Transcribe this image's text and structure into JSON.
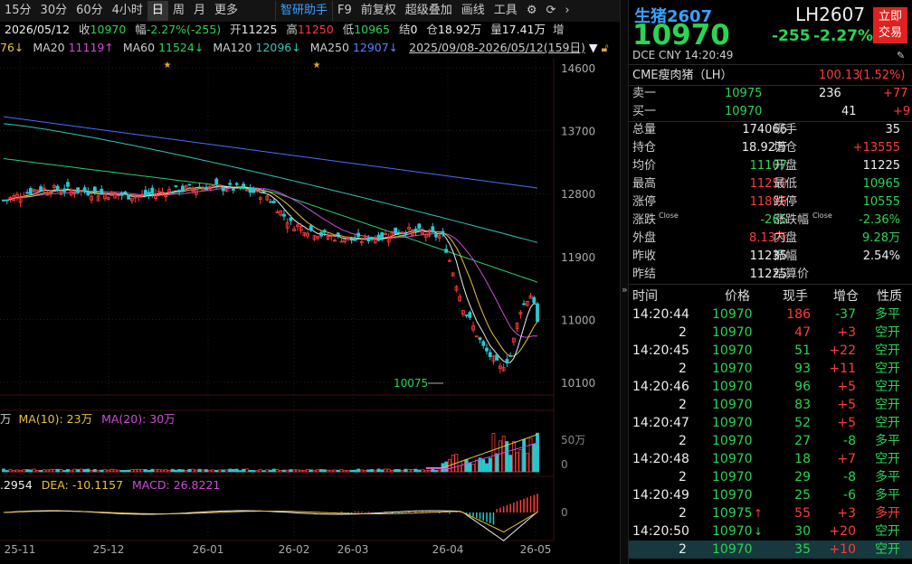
{
  "toolbar": {
    "items": [
      "15分",
      "30分",
      "60分",
      "4小时",
      "日",
      "周",
      "月",
      "更多"
    ],
    "active": "日",
    "assistant": "智研助手",
    "f9": "F9",
    "adjust": "前复权",
    "overlay": "超级叠加",
    "draw": "画线",
    "tools": "工具"
  },
  "infobar": {
    "date": "2026/05/12",
    "close_label": "收",
    "close": "10970",
    "chg_label": "幅",
    "chg": "-2.27%(-255)",
    "open_label": "开",
    "open": "11225",
    "high_label": "高",
    "high": "11250",
    "low_label": "低",
    "low": "10965",
    "settle_label": "结",
    "settle": "0",
    "oi_label": "仓",
    "oi": "18.92万",
    "vol_label": "量",
    "vol": "17.41万"
  },
  "mabar": {
    "ma5_tail": "76↓",
    "ma20_label": "MA20",
    "ma20": "11119↑",
    "ma60_label": "MA60",
    "ma60": "11524↓",
    "ma120_label": "MA120",
    "ma120": "12096↓",
    "ma250_label": "MA250",
    "ma250": "12907↓",
    "range": "2025/09/08-2026/05/12(159日)"
  },
  "vol_panel": {
    "ma10_label": "MA(10): 23万",
    "ma20_label": "MA(20): 30万",
    "prefix": "万",
    "axis_top": "50万",
    "axis_zero": "0"
  },
  "macd_panel": {
    "dif_tail": ".2954",
    "dea_label": "DEA: -10.1157",
    "macd_label": "MACD: 26.8221",
    "axis_zero": "0"
  },
  "chart_data": {
    "type": "candlestick",
    "y_ticks": [
      "14600",
      "13700",
      "12800",
      "11900",
      "11000",
      "10100"
    ],
    "ylim": [
      10100,
      14600
    ],
    "x_ticks": [
      "25-11",
      "25-12",
      "26-01",
      "26-02",
      "26-03",
      "26-04",
      "26-05"
    ],
    "low_annotation": "10075",
    "ma_colors": {
      "ma5": "#eeeeee",
      "ma10": "#e8c23a",
      "ma20": "#d04cd6",
      "ma60": "#2ecc71",
      "ma120": "#2fc4b8",
      "ma250": "#4a6cff"
    },
    "up_color": "#ff3b3b",
    "down_color": "#28c8d0"
  },
  "quote": {
    "name": "生猪2607",
    "code": "LH2607",
    "price": "10970",
    "change": "-255",
    "change_pct": "-2.27%",
    "trade_btn_1": "立即",
    "trade_btn_2": "交易",
    "exchange": "DCE",
    "currency": "CNY",
    "time": "14:20:49",
    "ref_name": "CME瘦肉猪（LH）",
    "ref_value": "100.13",
    "ref_pct": "(1.52%)",
    "ask_label": "卖一",
    "ask": "10975",
    "ask_vol": "236",
    "ask_chg": "+77",
    "bid_label": "买一",
    "bid": "10970",
    "bid_vol": "41",
    "bid_chg": "+9",
    "stats": [
      [
        "总量",
        "174066",
        "现手",
        "35"
      ],
      [
        "持仓",
        "18.92万",
        "增仓",
        "+13555"
      ],
      [
        "均价",
        "11107",
        "开盘",
        "11225"
      ],
      [
        "最高",
        "11250",
        "最低",
        "10965"
      ],
      [
        "涨停",
        "11895",
        "跌停",
        "10555"
      ],
      [
        "涨跌",
        "-265",
        "涨跌幅",
        "-2.36%"
      ],
      [
        "外盘",
        "8.13万",
        "内盘",
        "9.28万"
      ],
      [
        "昨收",
        "11235",
        "振幅",
        "2.54%"
      ],
      [
        "昨结",
        "11225",
        "结算价",
        ""
      ]
    ],
    "close_tag": "Close",
    "trades_header": [
      "时间",
      "价格",
      "现手",
      "增仓",
      "性质"
    ],
    "trades": [
      [
        "14:20:44",
        "10970",
        "",
        "186",
        "-37",
        "多平"
      ],
      [
        "2",
        "10970",
        "",
        "47",
        "+3",
        "空开"
      ],
      [
        "14:20:45",
        "10970",
        "",
        "51",
        "+22",
        "空开"
      ],
      [
        "2",
        "10970",
        "",
        "93",
        "+11",
        "空开"
      ],
      [
        "14:20:46",
        "10970",
        "",
        "96",
        "+5",
        "空开"
      ],
      [
        "2",
        "10970",
        "",
        "83",
        "+5",
        "空开"
      ],
      [
        "14:20:47",
        "10970",
        "",
        "52",
        "+5",
        "空开"
      ],
      [
        "2",
        "10970",
        "",
        "27",
        "-8",
        "多平"
      ],
      [
        "14:20:48",
        "10970",
        "",
        "18",
        "+7",
        "空开"
      ],
      [
        "2",
        "10970",
        "",
        "29",
        "-8",
        "多平"
      ],
      [
        "14:20:49",
        "10970",
        "",
        "25",
        "-6",
        "多平"
      ],
      [
        "2",
        "10975",
        "↑",
        "55",
        "+3",
        "多开"
      ],
      [
        "14:20:50",
        "10970",
        "↓",
        "30",
        "+20",
        "空开"
      ],
      [
        "2",
        "10970",
        "",
        "35",
        "+10",
        "空开"
      ]
    ]
  }
}
